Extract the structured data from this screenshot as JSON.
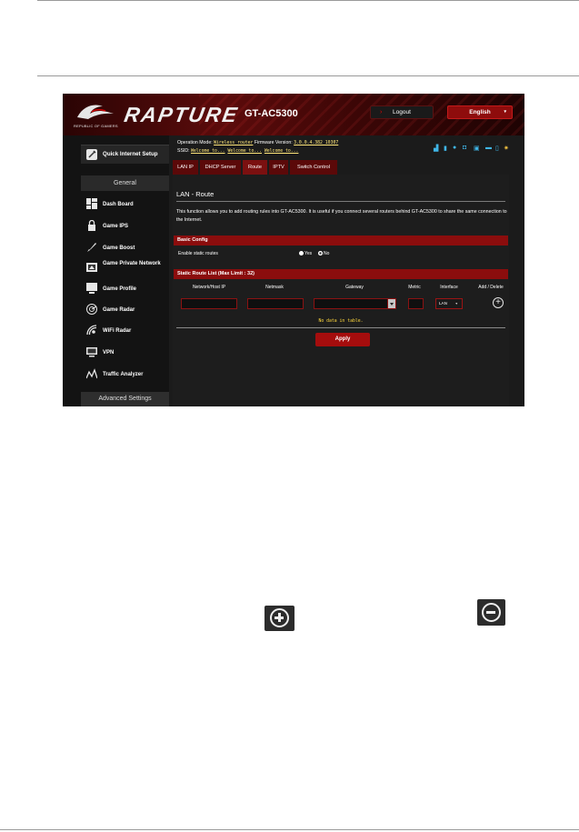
{
  "header": {
    "brand": "RAPTURE",
    "model": "GT-AC5300",
    "rog_text": "REPUBLIC OF GAMERS",
    "logout_label": "Logout",
    "language": "English"
  },
  "sidebar": {
    "quick_setup": "Quick Internet Setup",
    "general_label": "General",
    "items": [
      {
        "label": "Dash Board",
        "icon": "dashboard-icon"
      },
      {
        "label": "Game IPS",
        "icon": "lock-icon"
      },
      {
        "label": "Game Boost",
        "icon": "rocket-icon"
      },
      {
        "label": "Game Private Network",
        "icon": "network-icon"
      },
      {
        "label": "Game Profile",
        "icon": "profile-icon"
      },
      {
        "label": "Game Radar",
        "icon": "radar-icon"
      },
      {
        "label": "WiFi Radar",
        "icon": "wifi-radar-icon"
      },
      {
        "label": "VPN",
        "icon": "vpn-icon"
      },
      {
        "label": "Traffic Analyzer",
        "icon": "analyzer-icon"
      }
    ],
    "advanced_settings": "Advanced Settings"
  },
  "status": {
    "op_mode_label": "Operation Mode:",
    "op_mode_value": "Wireless router",
    "firmware_label": "Firmware Version:",
    "firmware_value": "3.0.0.4.382_10307",
    "ssid_label": "SSID:",
    "ssid_values": [
      "Welcome to...",
      "Welcome to...",
      "Welcome to..."
    ]
  },
  "tabs": [
    {
      "label": "LAN IP",
      "active": false
    },
    {
      "label": "DHCP Server",
      "active": false
    },
    {
      "label": "Route",
      "active": true
    },
    {
      "label": "IPTV",
      "active": false
    },
    {
      "label": "Switch Control",
      "active": false
    }
  ],
  "content": {
    "title": "LAN - Route",
    "description": "This function allows you to add routing rules into GT-AC5300. It is useful if you connect several routers behind GT-AC5300 to share the same connection to the Internet.",
    "basic_config": "Basic Config",
    "enable_static_label": "Enable static routes",
    "radio_yes": "Yes",
    "radio_no": "No",
    "selected": "No",
    "list_title": "Static Route List (Max Limit : 32)",
    "columns": [
      "Network/Host IP",
      "Netmask",
      "Gateway",
      "Metric",
      "Interface",
      "Add / Delete"
    ],
    "interface_value": "LAN",
    "no_data": "No data in table.",
    "apply_label": "Apply"
  },
  "colors": {
    "accent": "#8b0d0d",
    "panel": "#1d1d1d",
    "highlight": "#ffd83d"
  }
}
